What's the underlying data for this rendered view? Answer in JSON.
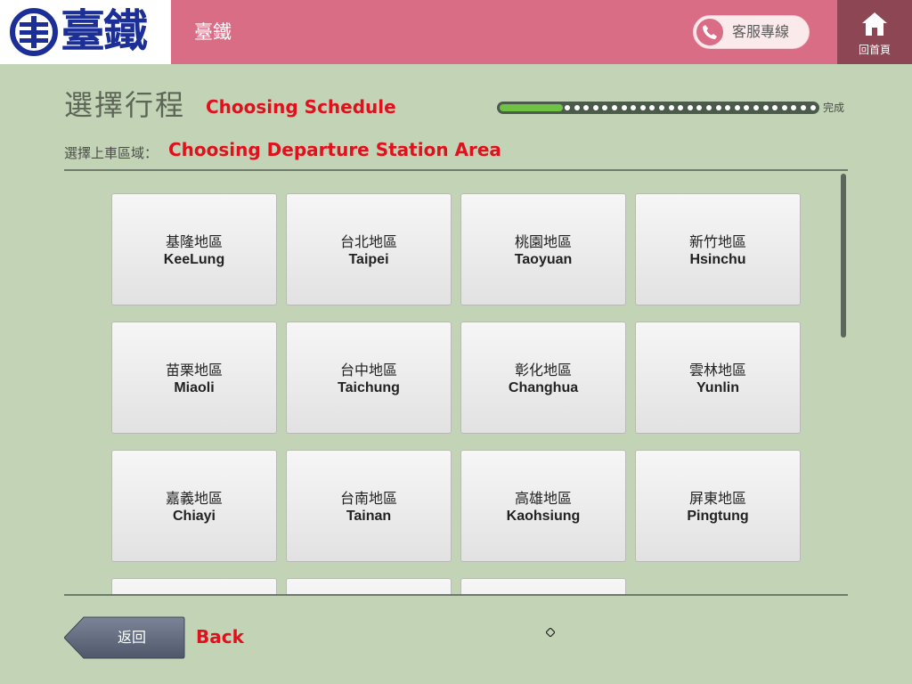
{
  "header": {
    "logo_text": "臺鐵",
    "title": "臺鐵",
    "hotline_label": "客服專線",
    "home_label": "回首頁",
    "colors": {
      "bar": "#d86d85",
      "home": "#8d4654",
      "logo": "#1b2f96"
    }
  },
  "page": {
    "title": "選擇行程",
    "title_en": "Choosing Schedule",
    "subtitle": "選擇上車區域：",
    "subtitle_en": "Choosing Departure Station Area"
  },
  "progress": {
    "completed_fraction": 0.2,
    "end_label": "完成"
  },
  "areas": [
    {
      "zh": "基隆地區",
      "en": "KeeLung"
    },
    {
      "zh": "台北地區",
      "en": "Taipei"
    },
    {
      "zh": "桃園地區",
      "en": "Taoyuan"
    },
    {
      "zh": "新竹地區",
      "en": "Hsinchu"
    },
    {
      "zh": "苗栗地區",
      "en": "Miaoli"
    },
    {
      "zh": "台中地區",
      "en": "Taichung"
    },
    {
      "zh": "彰化地區",
      "en": "Changhua"
    },
    {
      "zh": "雲林地區",
      "en": "Yunlin"
    },
    {
      "zh": "嘉義地區",
      "en": "Chiayi"
    },
    {
      "zh": "台南地區",
      "en": "Tainan"
    },
    {
      "zh": "高雄地區",
      "en": "Kaohsiung"
    },
    {
      "zh": "屏東地區",
      "en": "Pingtung"
    },
    {
      "zh": "",
      "en": ""
    },
    {
      "zh": "",
      "en": ""
    },
    {
      "zh": "",
      "en": ""
    }
  ],
  "footer": {
    "back_label": "返回",
    "back_en": "Back"
  },
  "icons": {
    "logo": "tra-logo-emblem",
    "hotline": "phone-icon",
    "home": "home-icon",
    "back": "back-arrow-button"
  },
  "accent_color": "#e0101d"
}
